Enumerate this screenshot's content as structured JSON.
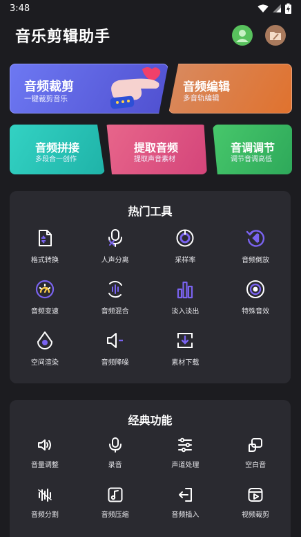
{
  "status_bar": {
    "time": "3:48"
  },
  "header": {
    "title": "音乐剪辑助手"
  },
  "feature_cards": {
    "trim": {
      "title": "音频裁剪",
      "subtitle": "一键裁剪音乐"
    },
    "edit": {
      "title": "音频编辑",
      "subtitle": "多音轨编辑"
    },
    "splice": {
      "title": "音频拼接",
      "subtitle": "多段合一创作"
    },
    "extract": {
      "title": "提取音频",
      "subtitle": "提取声音素材"
    },
    "pitch": {
      "title": "音调调节",
      "subtitle": "调节音调高低"
    }
  },
  "hot_tools": {
    "title": "热门工具",
    "items": [
      {
        "label": "格式转换",
        "icon": "format-convert-icon"
      },
      {
        "label": "人声分离",
        "icon": "vocal-separation-icon"
      },
      {
        "label": "采样率",
        "icon": "sample-rate-icon"
      },
      {
        "label": "音频倒放",
        "icon": "reverse-icon"
      },
      {
        "label": "音频变速",
        "icon": "speed-icon"
      },
      {
        "label": "音频混合",
        "icon": "mix-icon"
      },
      {
        "label": "淡入淡出",
        "icon": "fade-icon"
      },
      {
        "label": "特殊音效",
        "icon": "special-effect-icon"
      },
      {
        "label": "空间渲染",
        "icon": "spatial-render-icon"
      },
      {
        "label": "音频降噪",
        "icon": "noise-reduction-icon"
      },
      {
        "label": "素材下载",
        "icon": "download-icon"
      }
    ]
  },
  "classic_features": {
    "title": "经典功能",
    "items": [
      {
        "label": "音量调整",
        "icon": "volume-icon"
      },
      {
        "label": "录音",
        "icon": "microphone-icon"
      },
      {
        "label": "声道处理",
        "icon": "channel-sliders-icon"
      },
      {
        "label": "空白音",
        "icon": "blank-audio-icon"
      },
      {
        "label": "音频分割",
        "icon": "split-icon"
      },
      {
        "label": "音频压缩",
        "icon": "compress-icon"
      },
      {
        "label": "音频插入",
        "icon": "insert-icon"
      },
      {
        "label": "视频裁剪",
        "icon": "video-trim-icon"
      }
    ]
  },
  "colors": {
    "background": "#1c1c20",
    "panel": "#2a2a30",
    "hot_icon_accent": "#7a63f0",
    "trim_card": "#6d78f2",
    "edit_card": "#e0722e",
    "splice_card": "#2fc4b8",
    "extract_card": "#e0577f",
    "pitch_card": "#3fbd65"
  }
}
